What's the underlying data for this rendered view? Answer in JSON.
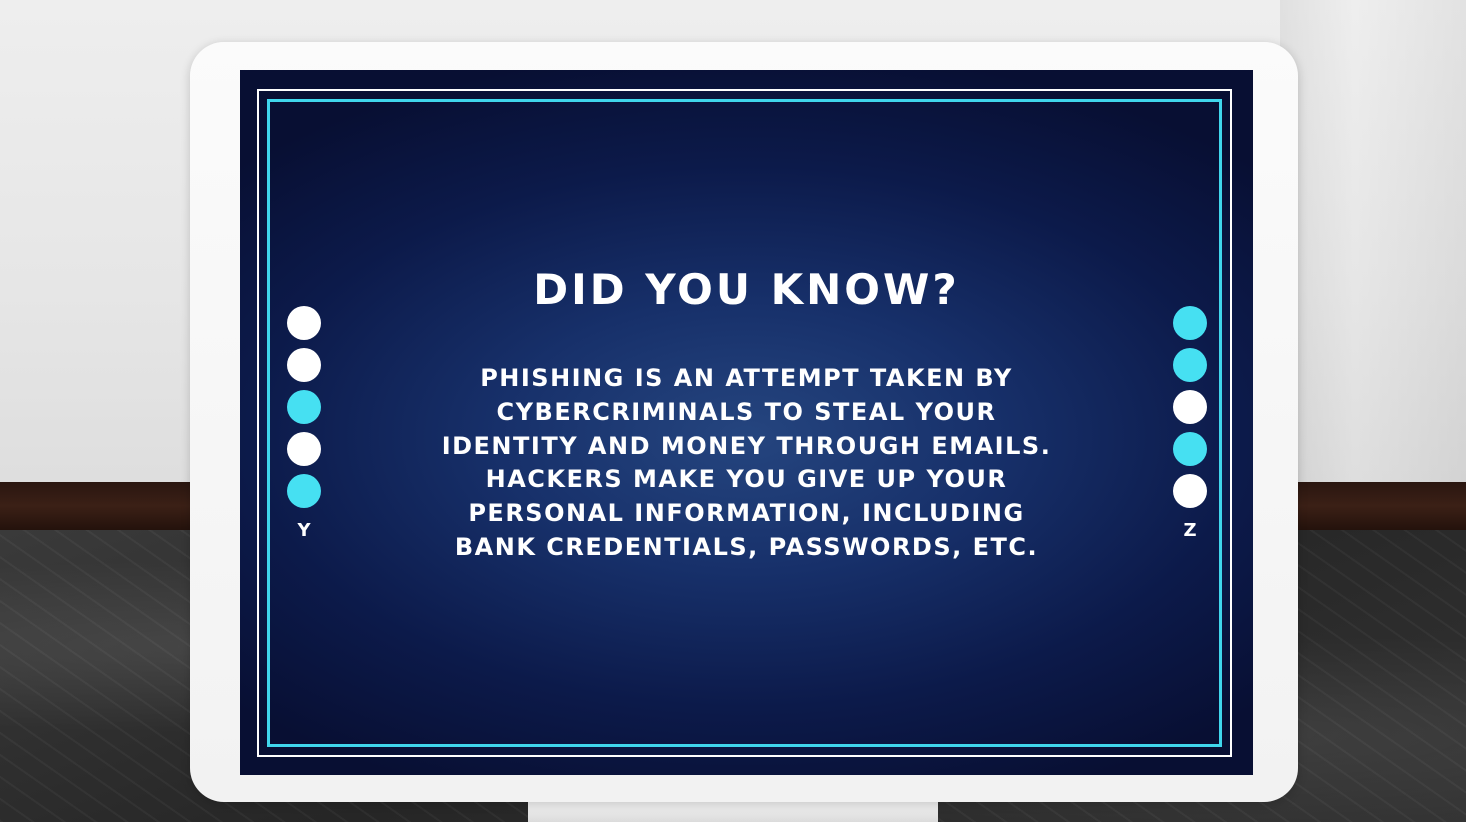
{
  "screen": {
    "title": "DID YOU KNOW?",
    "body_lines": [
      "PHISHING IS AN ATTEMPT TAKEN BY",
      "CYBERCRIMINALS TO STEAL YOUR",
      "IDENTITY AND MONEY THROUGH EMAILS.",
      "HACKERS MAKE YOU GIVE UP YOUR",
      "PERSONAL INFORMATION, INCLUDING",
      "BANK CREDENTIALS, PASSWORDS, ETC."
    ],
    "left_indicator": {
      "label": "Y",
      "dots": [
        "white",
        "white",
        "cyan",
        "white",
        "cyan"
      ]
    },
    "right_indicator": {
      "label": "Z",
      "dots": [
        "cyan",
        "cyan",
        "white",
        "cyan",
        "white"
      ]
    }
  },
  "colors": {
    "accent_cyan": "#46e0f2",
    "frame_cyan": "#40d6ec",
    "screen_bg": "#17306a",
    "text": "#ffffff"
  }
}
